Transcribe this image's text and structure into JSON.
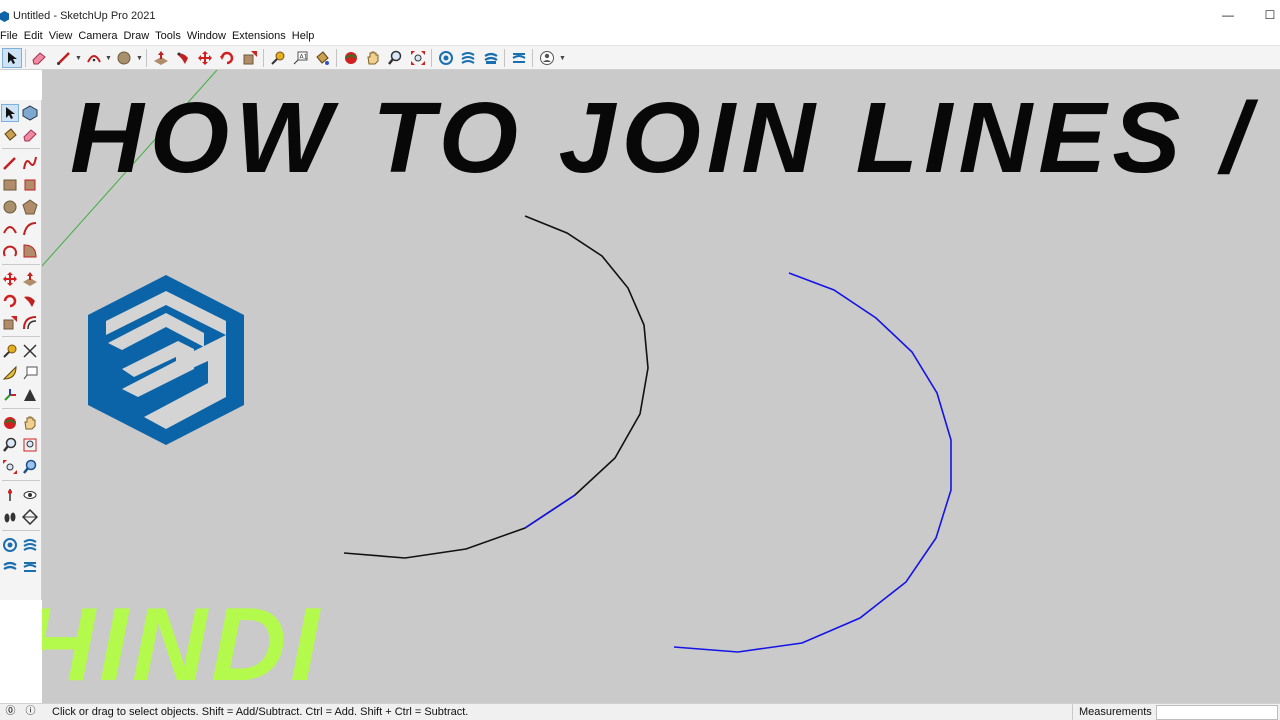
{
  "window": {
    "title": "Untitled - SketchUp Pro 2021",
    "minimize_glyph": "—",
    "maximize_glyph": "☐"
  },
  "menu": {
    "items": [
      "File",
      "Edit",
      "View",
      "Camera",
      "Draw",
      "Tools",
      "Window",
      "Extensions",
      "Help"
    ]
  },
  "toolbar": {
    "icons": [
      "select-icon",
      "eraser-icon",
      "line-icon",
      "arc-icon",
      "shape-icon",
      "push-pull-icon",
      "follow-me-icon",
      "move-icon",
      "rotate-icon",
      "scale-icon",
      "tape-measure-icon",
      "text-icon",
      "paint-bucket-icon",
      "orbit-icon",
      "pan-icon",
      "zoom-icon",
      "zoom-extents-icon",
      "warehouse-icon",
      "extension-warehouse-icon",
      "layout-icon",
      "styles-icon",
      "account-icon"
    ]
  },
  "canvas": {
    "headline": "HOW TO JOIN LINES / WELD",
    "tag": "HINDI",
    "colors": {
      "background": "#cacaca",
      "black_curve": "#111111",
      "selected_curve": "#1414e6",
      "logo": "#0b63a8",
      "tag": "#b4fa4c",
      "axis": "#3fae3f"
    }
  },
  "statusbar": {
    "hint": "Click or drag to select objects. Shift = Add/Subtract. Ctrl = Add. Shift + Ctrl = Subtract.",
    "measurements_label": "Measurements",
    "measurements_value": ""
  }
}
